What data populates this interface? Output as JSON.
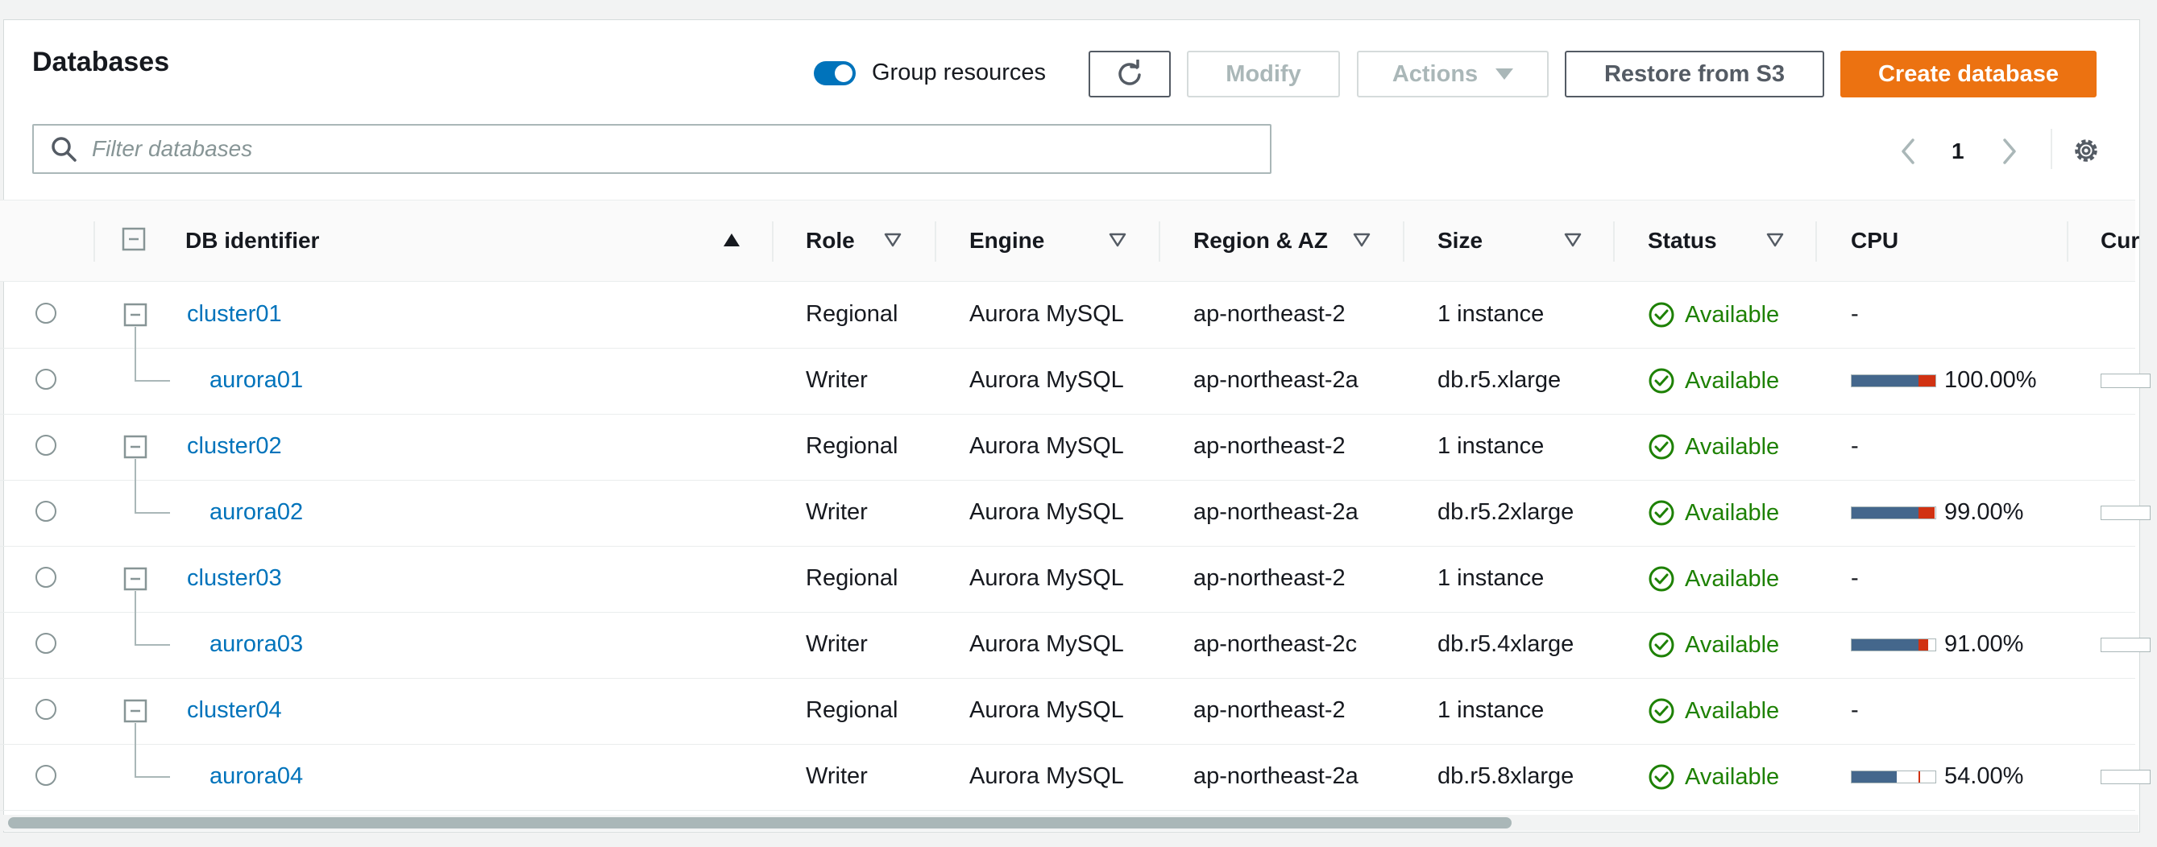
{
  "header": {
    "title": "Databases",
    "group_resources_label": "Group resources",
    "group_resources_on": true
  },
  "toolbar": {
    "modify_label": "Modify",
    "actions_label": "Actions",
    "restore_label": "Restore from S3",
    "create_label": "Create database"
  },
  "filter": {
    "placeholder": "Filter databases",
    "value": ""
  },
  "pagination": {
    "current_page": "1"
  },
  "columns": {
    "db_identifier": "DB identifier",
    "role": "Role",
    "engine": "Engine",
    "region": "Region & AZ",
    "size": "Size",
    "status": "Status",
    "cpu": "CPU",
    "current": "Cur"
  },
  "rows": [
    {
      "id": "cluster01",
      "role": "Regional",
      "engine": "Aurora MySQL",
      "region": "ap-northeast-2",
      "size": "1 instance",
      "status": "Available",
      "cpu": "-"
    },
    {
      "id": "aurora01",
      "role": "Writer",
      "engine": "Aurora MySQL",
      "region": "ap-northeast-2a",
      "size": "db.r5.xlarge",
      "status": "Available",
      "cpu": "100.00%",
      "cpu_value": 100
    },
    {
      "id": "cluster02",
      "role": "Regional",
      "engine": "Aurora MySQL",
      "region": "ap-northeast-2",
      "size": "1 instance",
      "status": "Available",
      "cpu": "-"
    },
    {
      "id": "aurora02",
      "role": "Writer",
      "engine": "Aurora MySQL",
      "region": "ap-northeast-2a",
      "size": "db.r5.2xlarge",
      "status": "Available",
      "cpu": "99.00%",
      "cpu_value": 99
    },
    {
      "id": "cluster03",
      "role": "Regional",
      "engine": "Aurora MySQL",
      "region": "ap-northeast-2",
      "size": "1 instance",
      "status": "Available",
      "cpu": "-"
    },
    {
      "id": "aurora03",
      "role": "Writer",
      "engine": "Aurora MySQL",
      "region": "ap-northeast-2c",
      "size": "db.r5.4xlarge",
      "status": "Available",
      "cpu": "91.00%",
      "cpu_value": 91
    },
    {
      "id": "cluster04",
      "role": "Regional",
      "engine": "Aurora MySQL",
      "region": "ap-northeast-2",
      "size": "1 instance",
      "status": "Available",
      "cpu": "-"
    },
    {
      "id": "aurora04",
      "role": "Writer",
      "engine": "Aurora MySQL",
      "region": "ap-northeast-2a",
      "size": "db.r5.8xlarge",
      "status": "Available",
      "cpu": "54.00%",
      "cpu_value": 54
    }
  ],
  "colors": {
    "link": "#0073bb",
    "primary": "#ec7211",
    "success": "#1d8102",
    "cpu_bar": "#44678c",
    "cpu_threshold": "#d13212"
  },
  "icons": [
    "search-icon",
    "refresh-icon",
    "caret-down-icon",
    "chevron-left-icon",
    "chevron-right-icon",
    "gear-icon",
    "collapse-icon",
    "sort-ascending-icon",
    "sort-icon",
    "status-check-icon"
  ]
}
